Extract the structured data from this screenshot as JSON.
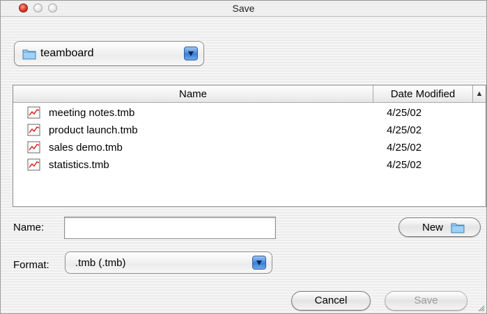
{
  "window": {
    "title": "Save"
  },
  "location": {
    "folder": "teamboard",
    "icon": "folder-icon"
  },
  "browser": {
    "columns": [
      "Name",
      "Date Modified"
    ],
    "files": [
      {
        "name": "meeting notes.tmb",
        "date": "4/25/02"
      },
      {
        "name": "product launch.tmb",
        "date": "4/25/02"
      },
      {
        "name": "sales demo.tmb",
        "date": "4/25/02"
      },
      {
        "name": "statistics.tmb",
        "date": "4/25/02"
      }
    ]
  },
  "form": {
    "name_label": "Name:",
    "name_value": "",
    "new_label": "New",
    "format_label": "Format:",
    "format_value": ".tmb (.tmb)"
  },
  "buttons": {
    "cancel": "Cancel",
    "save": "Save"
  },
  "colors": {
    "accent": "#3a7fd8",
    "close": "#e0483a"
  }
}
